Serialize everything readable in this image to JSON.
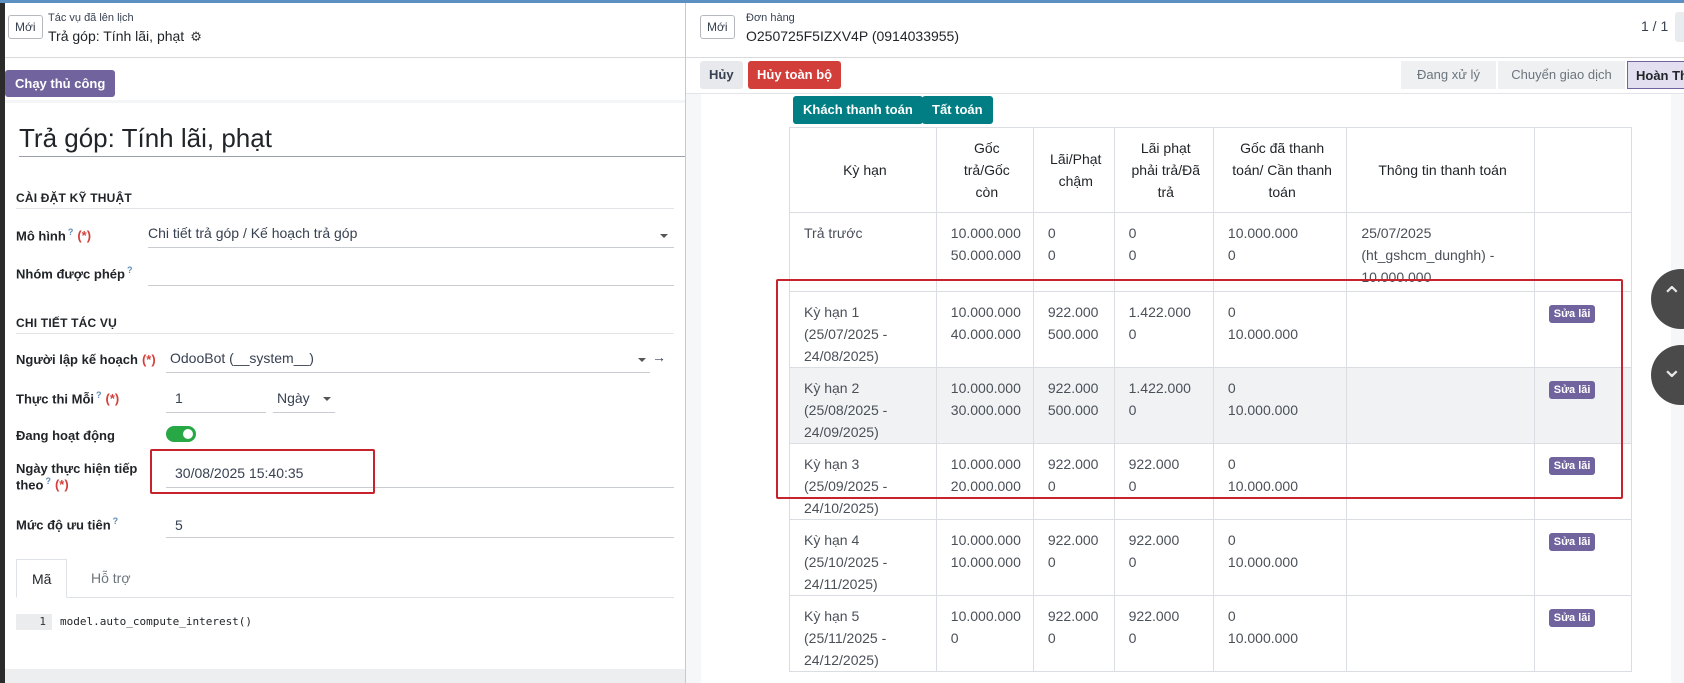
{
  "left": {
    "new_button": "Mới",
    "breadcrumb_parent": "Tác vụ đã lên lịch",
    "breadcrumb_current": "Trả góp: Tính lãi, phạt",
    "run_button": "Chạy thủ công",
    "title": "Trả góp: Tính lãi, phạt",
    "section_tech": "CÀI ĐẶT KỸ THUẬT",
    "model_label": "Mô hình",
    "model_value": "Chi tiết trả góp / Kế hoạch trả góp",
    "group_label": "Nhóm được phép",
    "section_detail": "CHI TIẾT TÁC VỤ",
    "planner_label": "Người lập kế hoạch",
    "planner_value": "OdooBot (__system__)",
    "every_label": "Thực thi Mỗi",
    "every_value": "1",
    "every_unit": "Ngày",
    "active_label": "Đang hoạt động",
    "next_label_1": "Ngày thực hiện tiếp",
    "next_label_2": "theo",
    "next_value": "30/08/2025 15:40:35",
    "priority_label": "Mức độ ưu tiên",
    "priority_value": "5",
    "tab_code": "Mã",
    "tab_help": "Hỗ trợ",
    "code_line_no": "1",
    "code_text": "model.auto_compute_interest()",
    "required_mark": "(*)",
    "help_mark": "?"
  },
  "right": {
    "new_button": "Mới",
    "breadcrumb_parent": "Đơn hàng",
    "breadcrumb_current": "O250725F5IZXV4P (0914033955)",
    "pager": "1 / 1",
    "cancel_button": "Hủy",
    "cancel_all_button": "Hủy toàn bộ",
    "stages": [
      "Đang xử lý",
      "Chuyển giao dịch",
      "Hoàn Th"
    ],
    "customer_pay_button": "Khách thanh toán",
    "settle_button": "Tất toán",
    "table": {
      "headers": [
        "Kỳ hạn",
        "Gốc trả/Gốc còn",
        "Lãi/Phạt chậm",
        "Lãi phạt phải trả/Đã trả",
        "Gốc đã thanh toán/ Cần thanh toán",
        "Thông tin thanh toán"
      ],
      "fix_label": "Sửa lãi",
      "rows": [
        {
          "term": "Trả trước",
          "principal": [
            "10.000.000",
            "50.000.000"
          ],
          "interest": [
            "0",
            "0"
          ],
          "penalty": [
            "0",
            "0"
          ],
          "paid": [
            "10.000.000",
            "0"
          ],
          "info": [
            "25/07/2025",
            "(ht_gshcm_dunghh) -",
            "10.000.000"
          ]
        },
        {
          "term": "Kỳ hạn 1 (25/07/2025 - 24/08/2025)",
          "principal": [
            "10.000.000",
            "40.000.000"
          ],
          "interest": [
            "922.000",
            "500.000"
          ],
          "penalty": [
            "1.422.000",
            "0"
          ],
          "paid": [
            "0",
            "10.000.000"
          ],
          "info": []
        },
        {
          "term": "Kỳ hạn 2 (25/08/2025 - 24/09/2025)",
          "principal": [
            "10.000.000",
            "30.000.000"
          ],
          "interest": [
            "922.000",
            "500.000"
          ],
          "penalty": [
            "1.422.000",
            "0"
          ],
          "paid": [
            "0",
            "10.000.000"
          ],
          "info": []
        },
        {
          "term": "Kỳ hạn 3 (25/09/2025 - 24/10/2025)",
          "principal": [
            "10.000.000",
            "20.000.000"
          ],
          "interest": [
            "922.000",
            "0"
          ],
          "penalty": [
            "922.000",
            "0"
          ],
          "paid": [
            "0",
            "10.000.000"
          ],
          "info": []
        },
        {
          "term": "Kỳ hạn 4 (25/10/2025 - 24/11/2025)",
          "principal": [
            "10.000.000",
            "10.000.000"
          ],
          "interest": [
            "922.000",
            "0"
          ],
          "penalty": [
            "922.000",
            "0"
          ],
          "paid": [
            "0",
            "10.000.000"
          ],
          "info": []
        },
        {
          "term": "Kỳ hạn 5 (25/11/2025 - 24/12/2025)",
          "principal": [
            "10.000.000",
            "0"
          ],
          "interest": [
            "922.000",
            "0"
          ],
          "penalty": [
            "922.000",
            "0"
          ],
          "paid": [
            "0",
            "10.000.000"
          ],
          "info": []
        }
      ]
    }
  },
  "colors": {
    "accent": "#71639e",
    "danger": "#d23f3a",
    "teal": "#017e84",
    "highlight": "#c8232c",
    "toggle_on": "#28a745"
  }
}
